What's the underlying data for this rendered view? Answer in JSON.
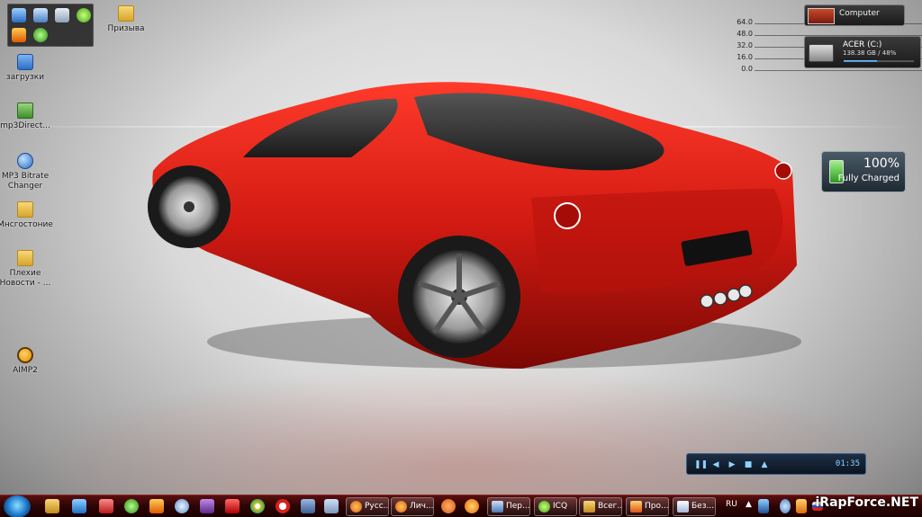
{
  "desktop": {
    "icons": [
      {
        "label": "Призыва"
      },
      {
        "label": "загрузки"
      },
      {
        "label": "mp3Direct..."
      },
      {
        "label": "MP3 Bitrate Changer"
      },
      {
        "label": "Мнсгостоние"
      },
      {
        "label": "Плехие Новости - ..."
      },
      {
        "label": "AIMP2"
      }
    ]
  },
  "gadgets": {
    "meter": {
      "ticks": [
        "64.0",
        "48.0",
        "32.0",
        "16.0",
        "0.0"
      ]
    },
    "computer": {
      "title": "Computer"
    },
    "drive": {
      "name": "ACER (C:)",
      "size": "138.38 GB / 48%",
      "fill_percent": 48
    },
    "battery": {
      "percent": "100%",
      "status": "Fully Charged"
    },
    "player": {
      "time": "01:35"
    }
  },
  "taskbar": {
    "buttons": [
      {
        "label": "Русс..."
      },
      {
        "label": "Лич..."
      },
      {
        "label": "Пер..."
      },
      {
        "label": "ICQ"
      },
      {
        "label": "Всег..."
      },
      {
        "label": "Про..."
      },
      {
        "label": "Без..."
      }
    ],
    "language": "RU"
  },
  "watermark": "iRapForce.NET",
  "colors": {
    "car_red": "#d11a12",
    "taskbar": "#3a0808",
    "accent_blue": "#2a87d6"
  }
}
